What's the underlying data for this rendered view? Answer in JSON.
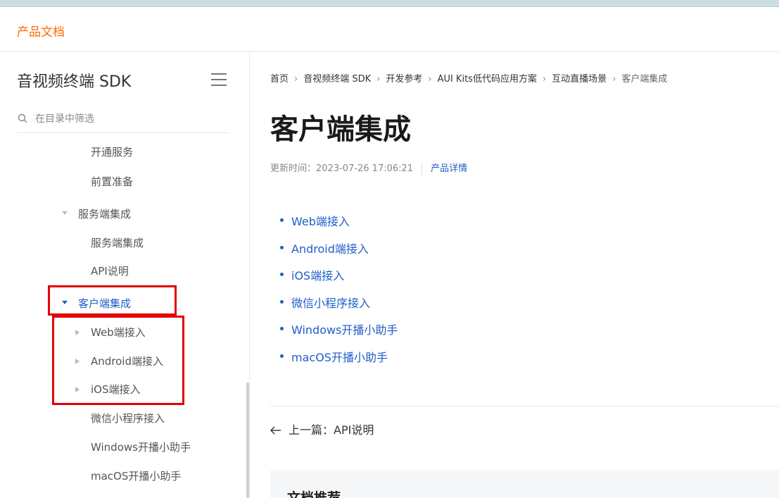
{
  "header": {
    "brand": "产品文档"
  },
  "sidebar": {
    "title": "音视频终端 SDK",
    "search_placeholder": "在目录中筛选",
    "items": [
      {
        "label": "开通服务",
        "expanded": null
      },
      {
        "label": "前置准备",
        "expanded": null
      },
      {
        "label": "服务端集成",
        "expanded": true
      },
      {
        "label": "服务端集成",
        "expanded": null
      },
      {
        "label": "API说明",
        "expanded": null
      },
      {
        "label": "客户端集成",
        "expanded": true,
        "active": true
      },
      {
        "label": "Web端接入",
        "expanded": false
      },
      {
        "label": "Android端接入",
        "expanded": false
      },
      {
        "label": "iOS端接入",
        "expanded": false
      },
      {
        "label": "微信小程序接入",
        "expanded": null
      },
      {
        "label": "Windows开播小助手",
        "expanded": null
      },
      {
        "label": "macOS开播小助手",
        "expanded": null
      }
    ]
  },
  "breadcrumb": [
    "首页",
    "音视频终端 SDK",
    "开发参考",
    "AUI Kits低代码应用方案",
    "互动直播场景",
    "客户端集成"
  ],
  "main": {
    "title": "客户端集成",
    "updated_label": "更新时间：2023-07-26 17:06:21",
    "product_link": "产品详情",
    "links": [
      "Web端接入",
      "Android端接入",
      "iOS端接入",
      "微信小程序接入",
      "Windows开播小助手",
      "macOS开播小助手"
    ],
    "prev_label": "上一篇：API说明",
    "rec_title": "文档推荐"
  },
  "colors": {
    "brand": "#ff6a00",
    "link": "#1f5ec9",
    "highlight": "#e30000"
  }
}
